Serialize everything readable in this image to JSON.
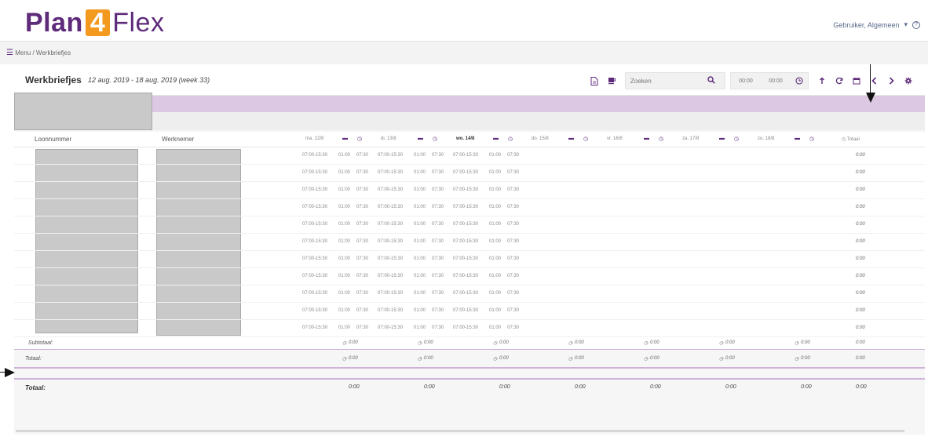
{
  "brand": {
    "part1": "Plan",
    "part2": "4",
    "part3": "Flex",
    "accent": "#f39a1e",
    "primary": "#5e2a7a"
  },
  "user": {
    "label": "Gebruiker, Algemeen",
    "caret": "▾",
    "help": "?"
  },
  "breadcrumb": {
    "menu": "Menu",
    "sep": "/",
    "current": "Werkbriefjes"
  },
  "header": {
    "title": "Werkbriefjes",
    "subtitle": "12 aug. 2019 - 18 aug. 2019 (week 33)",
    "search_placeholder": "Zoeken",
    "time_from": "00:00",
    "time_to": "00:00"
  },
  "table": {
    "col_loon": "Loonnummer",
    "col_werk": "Werknemer",
    "days": [
      "ma. 12/8",
      "di. 13/8",
      "wo. 14/8",
      "do. 15/8",
      "vr. 16/8",
      "za. 17/8",
      "zo. 18/8"
    ],
    "total_header": "Totaal",
    "row_values": {
      "shift": "07:00-15:30",
      "break": "01:00",
      "hours": "07:30"
    },
    "row_total": "0:00",
    "row_count": 11,
    "filled_days": 3
  },
  "subtotal": {
    "label": "Subtotaal:",
    "value": "0:00"
  },
  "total": {
    "label": "Totaal:",
    "value": "0:00"
  },
  "grand_total": {
    "label": "Totaal:",
    "value": "0:00"
  }
}
